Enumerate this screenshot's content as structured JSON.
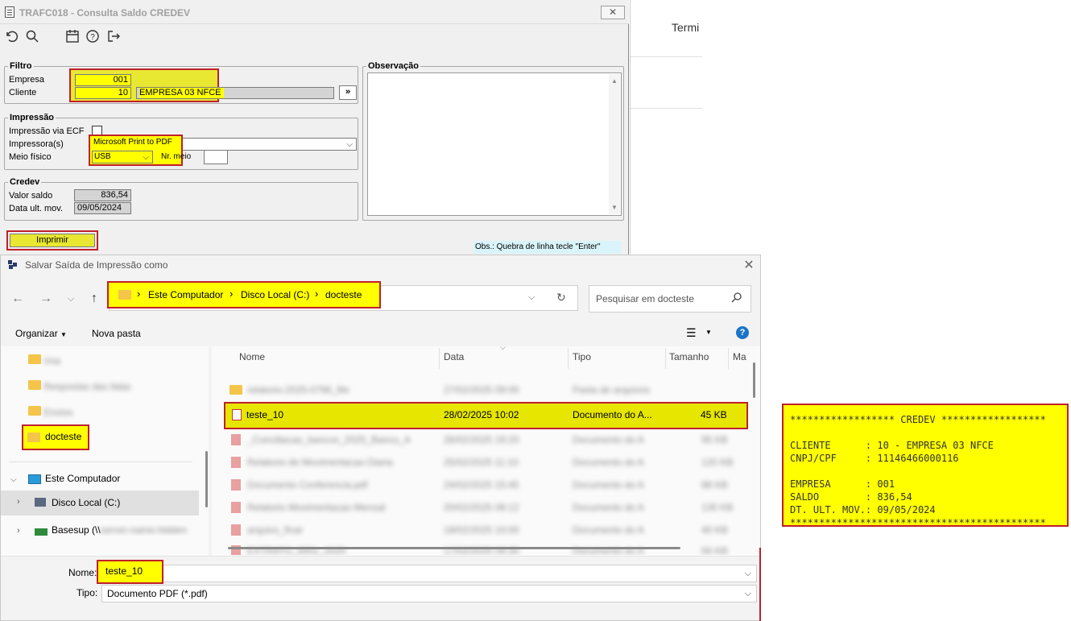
{
  "window1": {
    "title": "TRAFC018 - Consulta Saldo CREDEV",
    "close_label": "✕",
    "toolbar": [
      "undo-icon",
      "search-icon",
      "calendar-icon",
      "help-icon",
      "exit-icon"
    ],
    "filtro": {
      "legend": "Filtro",
      "empresa_label": "Empresa",
      "empresa_value": "001",
      "cliente_label": "Cliente",
      "cliente_value": "10",
      "cliente_name": "EMPRESA 03 NFCE",
      "lookup_label": "»"
    },
    "impressao": {
      "legend": "Impressão",
      "ecf_label": "Impressão via ECF",
      "impressora_label": "Impressora(s)",
      "impressora_value": "Microsoft Print to PDF",
      "meio_label": "Meio físico",
      "meio_value": "USB",
      "nr_meio_label": "Nr. meio"
    },
    "credev": {
      "legend": "Credev",
      "valor_label": "Valor saldo",
      "valor_value": "836,54",
      "data_label": "Data ult. mov.",
      "data_value": "09/05/2024"
    },
    "observacao_legend": "Observação",
    "imprimir_label": "Imprimir",
    "obs_hint": "Obs.: Quebra de linha tecle \"Enter\""
  },
  "background": {
    "termi": "Termi"
  },
  "dialog": {
    "title": "Salvar Saída de Impressão como",
    "close_label": "✕",
    "breadcrumb": [
      "Este Computador",
      "Disco Local (C:)",
      "docteste"
    ],
    "search_placeholder": "Pesquisar em docteste",
    "organizar_label": "Organizar",
    "nova_pasta_label": "Nova pasta",
    "columns": {
      "nome": "Nome",
      "data": "Data",
      "tipo": "Tipo",
      "tamanho": "Tamanho",
      "ma": "Ma"
    },
    "sidebar": {
      "folders_blurred": [
        "rma",
        "Respostas das falas",
        "Envios"
      ],
      "selected_folder": "docteste",
      "este_computador": "Este Computador",
      "disco_local": "Disco Local (C:)",
      "basesup": "Basesup (\\\\"
    },
    "selected_file": {
      "name": "teste_10",
      "date": "28/02/2025 10:02",
      "type": "Documento do A...",
      "size": "45 KB"
    },
    "blurred_rows": [
      {
        "name": "relatorio-2025-0796_file",
        "date": "27/02/2025 09:00",
        "type": "Pasta de arquivos",
        "size": ""
      },
      {
        "name": "_Conciliacao_bancos_2025_Banco_A",
        "date": "26/02/2025 16:20",
        "type": "Documento do A",
        "size": "95 KB"
      },
      {
        "name": "Relatorio de Movimentacao Diaria",
        "date": "25/02/2025 11:10",
        "type": "Documento do A",
        "size": "120 KB"
      },
      {
        "name": "Documento Conferencia.pdf",
        "date": "24/02/2025 15:45",
        "type": "Documento do A",
        "size": "88 KB"
      },
      {
        "name": "Relatorio Movimentacao Mensal",
        "date": "20/02/2025 08:12",
        "type": "Documento do A",
        "size": "130 KB"
      },
      {
        "name": "arquivo_final",
        "date": "18/02/2025 10:00",
        "type": "Documento do A",
        "size": "40 KB"
      },
      {
        "name": "EXTRATO_0001_2025",
        "date": "17/02/2025 09:30",
        "type": "Documento do A",
        "size": "56 KB"
      }
    ],
    "nome_label": "Nome:",
    "nome_value": "teste_10",
    "tipo_label": "Tipo:",
    "tipo_value": "Documento PDF (*.pdf)"
  },
  "receipt": {
    "text": "****************** CREDEV ******************\n\nCLIENTE      : 10 - EMPRESA 03 NFCE\nCNPJ/CPF     : 11146466000116\n\nEMPRESA      : 001\nSALDO        : 836,54\nDT. ULT. MOV.: 09/05/2024\n********************************************"
  }
}
